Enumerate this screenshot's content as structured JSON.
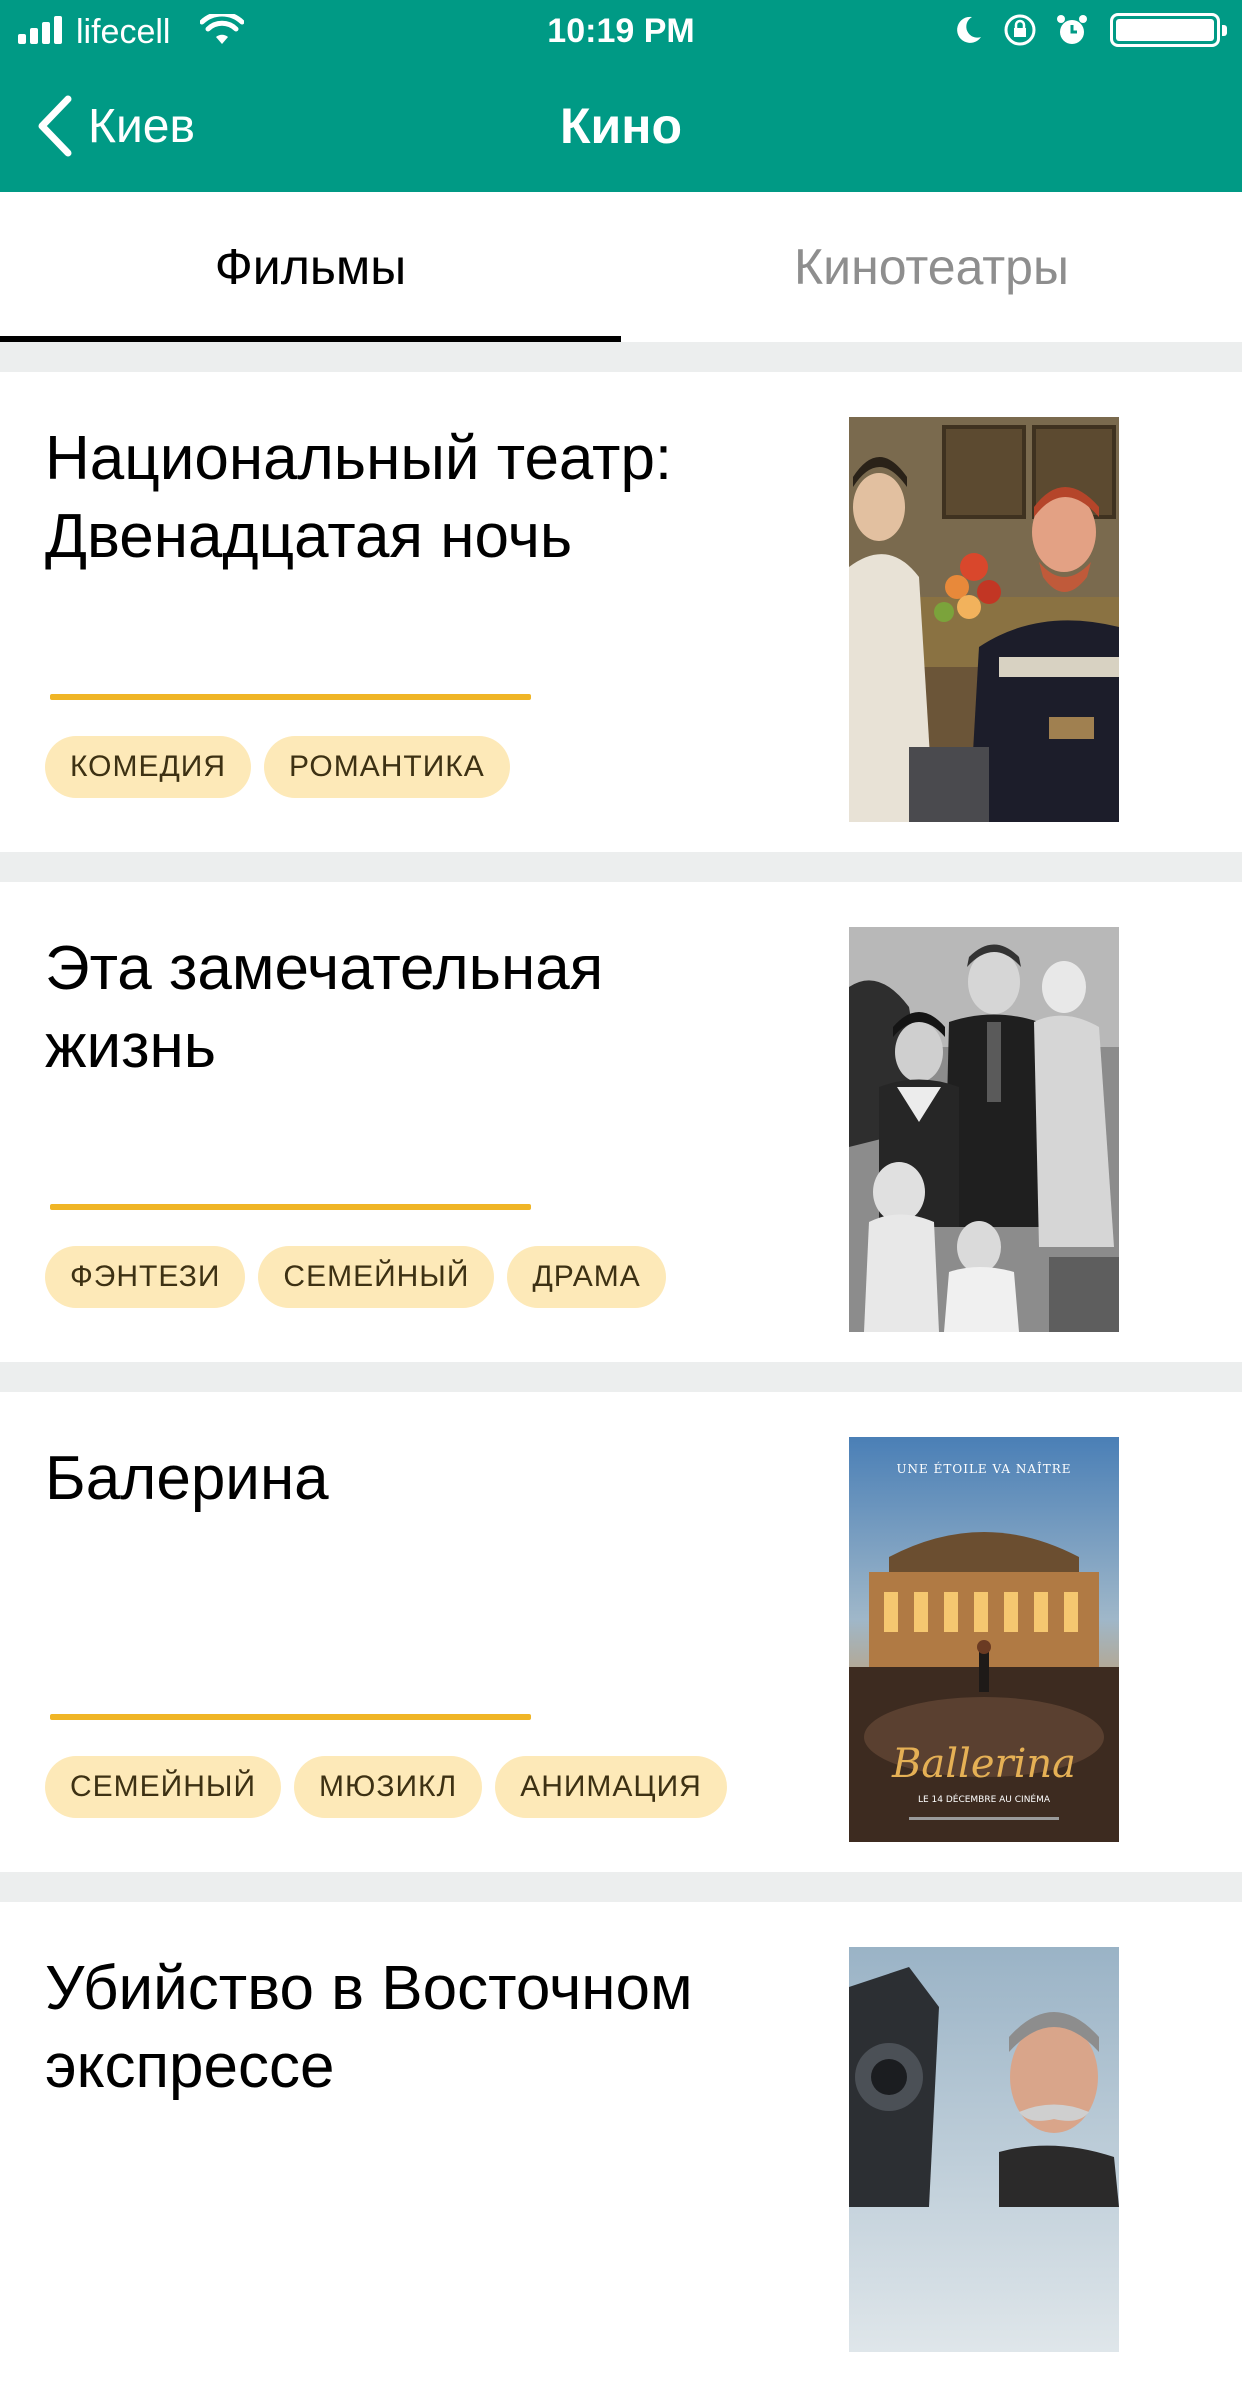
{
  "status_bar": {
    "carrier": "lifecell",
    "time": "10:19 PM"
  },
  "navbar": {
    "back_label": "Киев",
    "title": "Кино"
  },
  "tabs": [
    {
      "label": "Фильмы",
      "active": true
    },
    {
      "label": "Кинотеатры",
      "active": false
    }
  ],
  "movies": [
    {
      "title": "Национальный театр: Двенадцатая ночь",
      "genres": [
        "КОМЕДИЯ",
        "РОМАНТИКА"
      ]
    },
    {
      "title": "Эта замечательная жизнь",
      "genres": [
        "ФЭНТЕЗИ",
        "СЕМЕЙНЫЙ",
        "ДРАМА"
      ]
    },
    {
      "title": "Балерина",
      "genres": [
        "СЕМЕЙНЫЙ",
        "МЮЗИКЛ",
        "АНИМАЦИЯ"
      ],
      "poster_text": {
        "tagline": "UNE ÉTOILE VA NAÎTRE",
        "title": "Ballerina",
        "release": "LE 14 DÉCEMBRE AU CINÉMA"
      }
    },
    {
      "title": "Убийство в Восточном экспрессе",
      "genres": []
    }
  ],
  "colors": {
    "header": "#009a85",
    "accent_line": "#f0b526",
    "tag_bg": "#fde9b8",
    "tag_text": "#3d3113",
    "separator": "#eceeee"
  }
}
